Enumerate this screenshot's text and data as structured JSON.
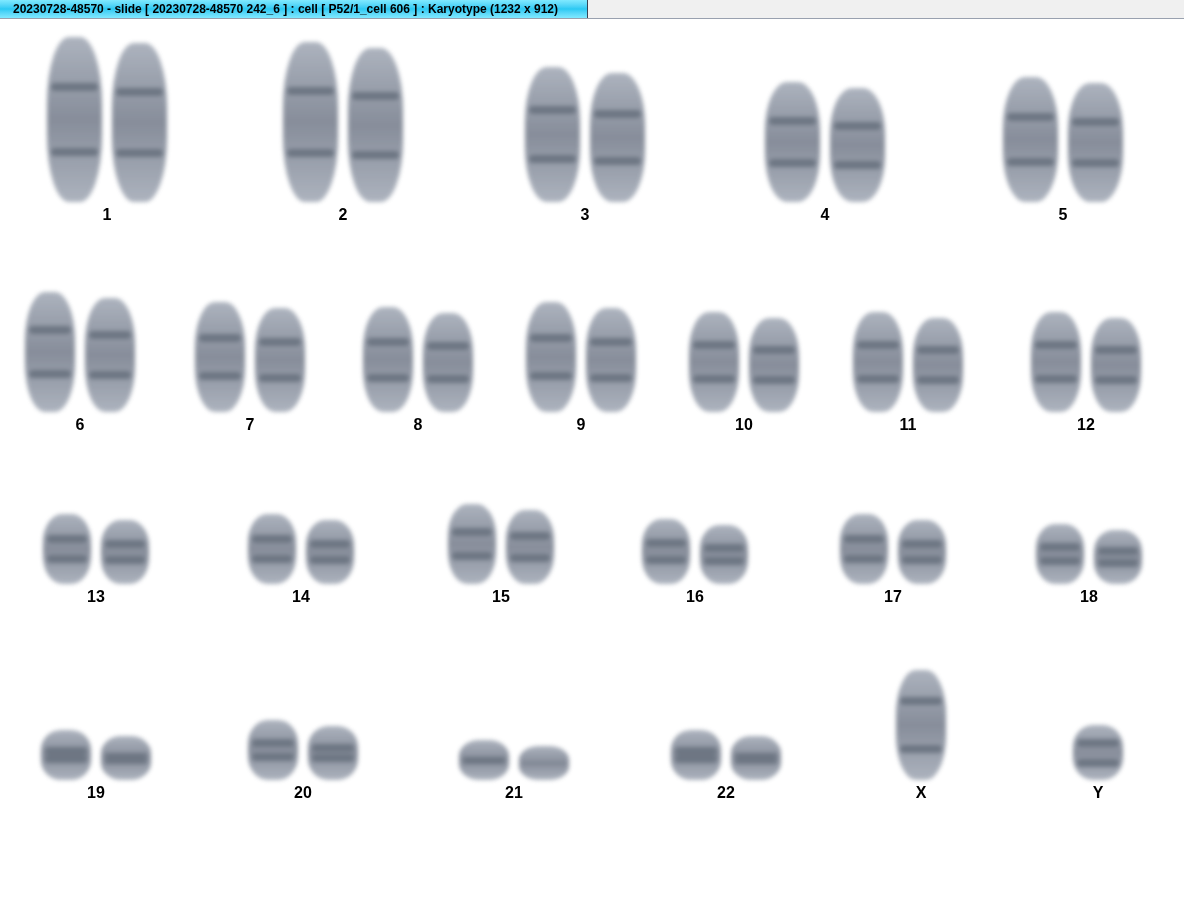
{
  "window": {
    "title": "20230728-48570 - slide [ 20230728-48570 242_6 ] : cell [ P52/1_cell 606 ] : Karyotype  (1232 x 912)"
  },
  "karyotype": [
    {
      "label": "1",
      "kind": "pair"
    },
    {
      "label": "2",
      "kind": "pair"
    },
    {
      "label": "3",
      "kind": "pair"
    },
    {
      "label": "4",
      "kind": "pair"
    },
    {
      "label": "5",
      "kind": "pair"
    },
    {
      "label": "6",
      "kind": "pair"
    },
    {
      "label": "7",
      "kind": "pair"
    },
    {
      "label": "8",
      "kind": "pair"
    },
    {
      "label": "9",
      "kind": "pair"
    },
    {
      "label": "10",
      "kind": "pair"
    },
    {
      "label": "11",
      "kind": "pair"
    },
    {
      "label": "12",
      "kind": "pair"
    },
    {
      "label": "13",
      "kind": "pair"
    },
    {
      "label": "14",
      "kind": "pair"
    },
    {
      "label": "15",
      "kind": "pair"
    },
    {
      "label": "16",
      "kind": "pair"
    },
    {
      "label": "17",
      "kind": "pair"
    },
    {
      "label": "18",
      "kind": "pair"
    },
    {
      "label": "19",
      "kind": "pair"
    },
    {
      "label": "20",
      "kind": "pair"
    },
    {
      "label": "21",
      "kind": "pair"
    },
    {
      "label": "22",
      "kind": "pair"
    },
    {
      "label": "X",
      "kind": "single"
    },
    {
      "label": "Y",
      "kind": "single"
    }
  ]
}
